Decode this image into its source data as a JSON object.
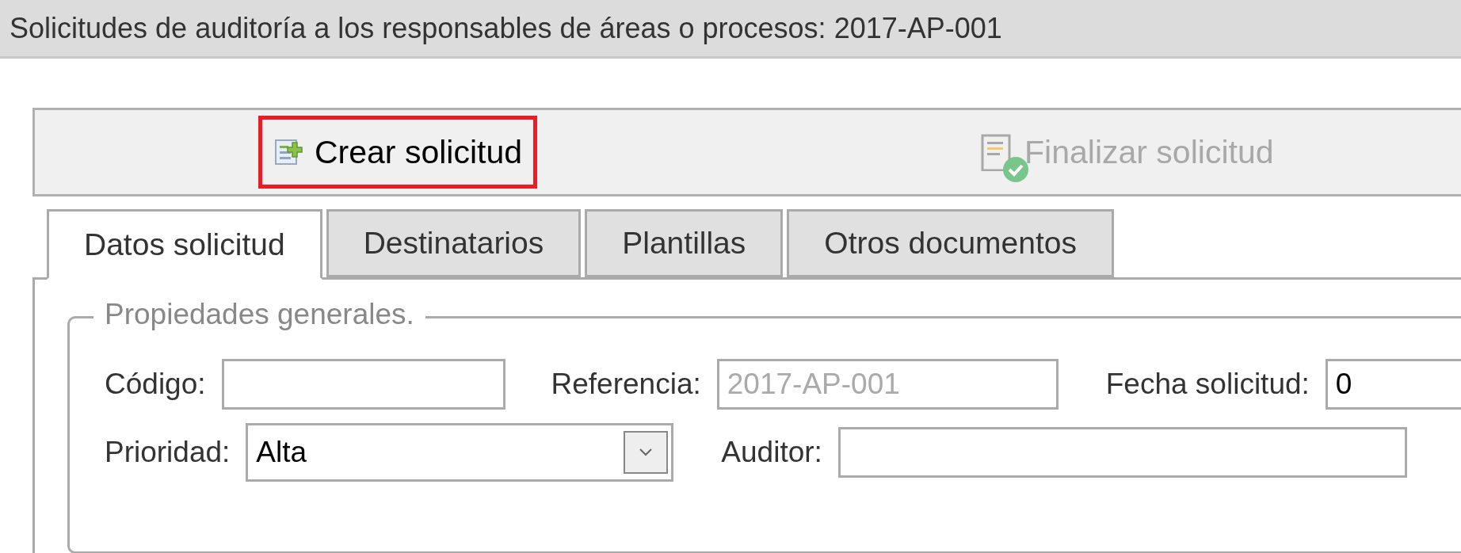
{
  "window": {
    "title": "Solicitudes de auditoría a los responsables de áreas o procesos: 2017-AP-001"
  },
  "toolbar": [
    {
      "kind": "create",
      "label": "Crear solicitud",
      "disabled": false,
      "highlighted": true
    },
    {
      "kind": "finish",
      "label": "Finalizar solicitud",
      "disabled": true,
      "highlighted": false
    }
  ],
  "tabs": [
    {
      "label": "Datos solicitud",
      "selected": true
    },
    {
      "label": "Destinatarios",
      "selected": false
    },
    {
      "label": "Plantillas",
      "selected": false
    },
    {
      "label": "Otros documentos",
      "selected": false
    }
  ],
  "fieldset": {
    "legend": "Propiedades generales.",
    "rows": [
      [
        {
          "label": "Código:",
          "kind": "text"
        },
        {
          "label": "Referencia:",
          "kind": "text",
          "value": "2017-AP-001",
          "disabled": true
        },
        {
          "label": "Fecha solicitud:",
          "kind": "text",
          "value": "0"
        }
      ],
      [
        {
          "label": "Prioridad:",
          "kind": "select",
          "value": "Alta"
        },
        {
          "label": "Auditor:",
          "kind": "text"
        }
      ]
    ]
  }
}
